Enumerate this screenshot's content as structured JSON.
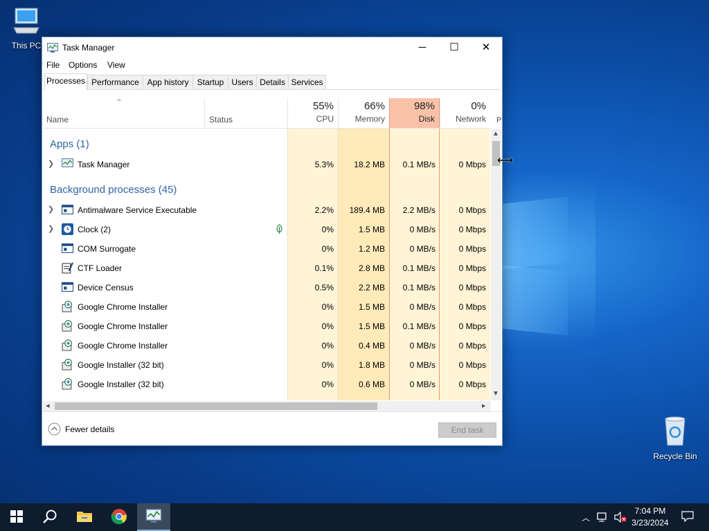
{
  "desktop": {
    "icons": [
      {
        "label": "This PC",
        "icon": "computer-icon"
      },
      {
        "label": "Recycle Bin",
        "icon": "recycle-bin-icon"
      }
    ]
  },
  "window": {
    "title": "Task Manager",
    "menu": [
      "File",
      "Options",
      "View"
    ],
    "tabs": [
      "Processes",
      "Performance",
      "App history",
      "Startup",
      "Users",
      "Details",
      "Services"
    ],
    "active_tab": "Processes",
    "columns": {
      "name": "Name",
      "status": "Status",
      "cpu": {
        "pct": "55%",
        "label": "CPU"
      },
      "memory": {
        "pct": "66%",
        "label": "Memory"
      },
      "disk": {
        "pct": "98%",
        "label": "Disk"
      },
      "network": {
        "pct": "0%",
        "label": "Network"
      },
      "power_partial": "P"
    },
    "groups": [
      {
        "label": "Apps (1)"
      },
      {
        "label": "Background processes (45)"
      }
    ],
    "processes": [
      {
        "name": "Task Manager",
        "status": "",
        "cpu": "5.3%",
        "memory": "18.2 MB",
        "disk": "0.1 MB/s",
        "network": "0 Mbps",
        "icon": "task-manager-icon",
        "expandable": true
      },
      {
        "name": "Antimalware Service Executable",
        "status": "",
        "cpu": "2.2%",
        "memory": "189.4 MB",
        "disk": "2.2 MB/s",
        "network": "0 Mbps",
        "icon": "service-window-icon",
        "expandable": true
      },
      {
        "name": "Clock (2)",
        "status": "suspended-leaf",
        "cpu": "0%",
        "memory": "1.5 MB",
        "disk": "0 MB/s",
        "network": "0 Mbps",
        "icon": "clock-icon",
        "expandable": true
      },
      {
        "name": "COM Surrogate",
        "status": "",
        "cpu": "0%",
        "memory": "1.2 MB",
        "disk": "0 MB/s",
        "network": "0 Mbps",
        "icon": "service-window-icon",
        "expandable": false
      },
      {
        "name": "CTF Loader",
        "status": "",
        "cpu": "0.1%",
        "memory": "2.8 MB",
        "disk": "0.1 MB/s",
        "network": "0 Mbps",
        "icon": "ctf-loader-icon",
        "expandable": false
      },
      {
        "name": "Device Census",
        "status": "",
        "cpu": "0.5%",
        "memory": "2.2 MB",
        "disk": "0.1 MB/s",
        "network": "0 Mbps",
        "icon": "service-window-icon",
        "expandable": false
      },
      {
        "name": "Google Chrome Installer",
        "status": "",
        "cpu": "0%",
        "memory": "1.5 MB",
        "disk": "0 MB/s",
        "network": "0 Mbps",
        "icon": "installer-icon",
        "expandable": false
      },
      {
        "name": "Google Chrome Installer",
        "status": "",
        "cpu": "0%",
        "memory": "1.5 MB",
        "disk": "0.1 MB/s",
        "network": "0 Mbps",
        "icon": "installer-icon",
        "expandable": false
      },
      {
        "name": "Google Chrome Installer",
        "status": "",
        "cpu": "0%",
        "memory": "0.4 MB",
        "disk": "0 MB/s",
        "network": "0 Mbps",
        "icon": "installer-icon",
        "expandable": false
      },
      {
        "name": "Google Installer (32 bit)",
        "status": "",
        "cpu": "0%",
        "memory": "1.8 MB",
        "disk": "0 MB/s",
        "network": "0 Mbps",
        "icon": "installer-icon",
        "expandable": false
      },
      {
        "name": "Google Installer (32 bit)",
        "status": "",
        "cpu": "0%",
        "memory": "0.6 MB",
        "disk": "0 MB/s",
        "network": "0 Mbps",
        "icon": "installer-icon",
        "expandable": false
      }
    ],
    "footer": {
      "fewer_details": "Fewer details",
      "end_task": "End task"
    }
  },
  "taskbar": {
    "items": [
      "start-icon",
      "search-icon",
      "file-explorer-icon",
      "chrome-icon",
      "task-manager-icon"
    ],
    "clock": {
      "time": "7:04 PM",
      "date": "3/23/2024"
    }
  },
  "colors": {
    "heat_light": "#fff4d6",
    "heat_mid": "#ffeaba",
    "disk_header": "#f9c2a8",
    "group_text": "#2e64a6",
    "taskbar": "#0e1c2e"
  }
}
